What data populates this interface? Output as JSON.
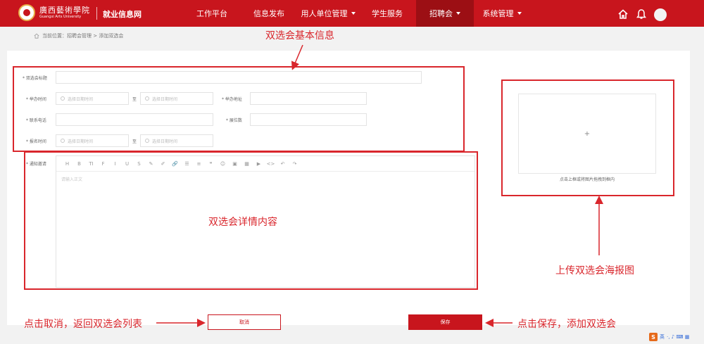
{
  "header": {
    "logo_cn": "廣西藝術學院",
    "logo_en": "Guangxi Arts University",
    "site_name": "就业信息网",
    "nav": [
      {
        "label": "工作平台"
      },
      {
        "label": "信息发布"
      },
      {
        "label": "用人单位管理"
      },
      {
        "label": "学生服务"
      },
      {
        "label": "招聘会"
      },
      {
        "label": "系统管理"
      }
    ],
    "icons": [
      "home-icon",
      "bell-icon",
      "avatar"
    ]
  },
  "breadcrumb": "当前位置：招聘会管理 > 添加双选会",
  "form": {
    "title_label": "* 双选会标题",
    "hold_time_label": "* 举办时间",
    "hold_addr_label": "* 举办地址",
    "phone_label": "* 联系电话",
    "booth_label": "* 展位数",
    "signup_time_label": "* 报名时间",
    "notice_label": "* 通知邀请",
    "date_placeholder": "选择日期时间",
    "to_text": "至",
    "editor_placeholder": "请输入正文",
    "toolbar": [
      "H",
      "B",
      "TI",
      "F",
      "I",
      "U",
      "S",
      "✎",
      "✐",
      "🔗",
      "☰",
      "≡",
      "❝",
      "☺",
      "▣",
      "▦",
      "▶",
      "<>",
      "↶",
      "↷"
    ]
  },
  "upload": {
    "plus": "+",
    "hint": "点击上框或将图片拖拽到框内"
  },
  "buttons": {
    "cancel": "取消",
    "save": "保存"
  },
  "annotations": {
    "basic_info": "双选会基本信息",
    "detail": "双选会详情内容",
    "poster": "上传双选会海报图",
    "cancel_note": "点击取消，返回双选会列表",
    "save_note": "点击保存，添加双选会"
  },
  "ime": {
    "s": "S",
    "lang": "英",
    "symbols": "·, ♪ ⌨ ▦"
  },
  "colors": {
    "brand_red": "#c8151d",
    "nav_active": "#9c0f14",
    "annotation_red": "#d9262c"
  }
}
